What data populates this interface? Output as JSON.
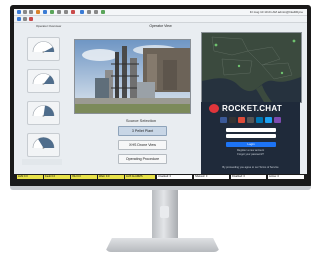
{
  "app": {
    "title": "Operator View",
    "toolbar_info": "Fri Aug 10 10:21 AM   admin@IntelliDyne",
    "toolbar_file": "Operator Overview"
  },
  "gauges": [
    {
      "value": "0",
      "level": 0.35
    },
    {
      "value": "0",
      "level": 0.5
    },
    {
      "value": "0",
      "level": 0.6
    },
    {
      "value": "0",
      "level": 0.75
    }
  ],
  "source_selection": {
    "label": "Source Selection",
    "buttons": [
      {
        "label": "3 Pellet Plant",
        "active": true
      },
      {
        "label": "XHS Drone View",
        "active": false
      },
      {
        "label": "Operating Procedure",
        "active": false
      }
    ]
  },
  "chat": {
    "title": "ROCKET.CHAT",
    "login_label": "Login",
    "register_link": "Register a new account",
    "forgot_link": "Forgot your password?",
    "footer": "By proceeding you agree to our Terms of Service"
  },
  "status_bar": [
    {
      "label": "ALM 0.0",
      "color": "#e8e24a"
    },
    {
      "label": "Fault 0.0",
      "color": "#e8e24a"
    },
    {
      "label": "INH 0.0",
      "color": "#e8e24a"
    },
    {
      "label": "Warn 0.0",
      "color": "#e8e24a"
    },
    {
      "label": "AUX ALARMS",
      "color": "#e8e24a"
    },
    {
      "label": "Unacked: 0",
      "color": "#ffffff"
    },
    {
      "label": "Shelved: 0",
      "color": "#ffffff"
    },
    {
      "label": "Disabled: 0",
      "color": "#ffffff"
    },
    {
      "label": "Active: 0",
      "color": "#ffffff"
    }
  ],
  "colors": {
    "accent": "#1d74f5",
    "chat_bg": "#1f2a3a",
    "alarm": "#e0353b"
  }
}
